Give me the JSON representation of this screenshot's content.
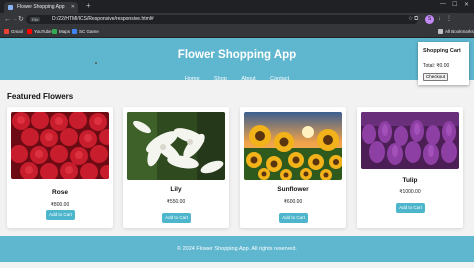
{
  "browser": {
    "tab_title": "Flower Shopping App",
    "url": "D:/22/HTMl/ICS/Responsive/responsive.html#",
    "file_chip": "File",
    "profile_letter": "S",
    "bookmarks": [
      {
        "label": "Gmail",
        "color": "#ea4335"
      },
      {
        "label": "YouTube",
        "color": "#ff0000"
      },
      {
        "label": "Maps",
        "color": "#34a853"
      },
      {
        "label": "SC Game",
        "color": "#4285f4"
      }
    ],
    "all_bookmarks": "All Bookmarks"
  },
  "header": {
    "title": "Flower Shopping App",
    "nav": [
      "Home",
      "Shop",
      "About",
      "Contact"
    ]
  },
  "cart": {
    "title": "Shopping Cart",
    "total": "Total: ₹0.00",
    "checkout": "Checkout"
  },
  "section": {
    "title": "Featured Flowers"
  },
  "products": [
    {
      "name": "Rose",
      "price": "₹800.00",
      "button": "Add to Cart",
      "image": "red-roses"
    },
    {
      "name": "Lily",
      "price": "₹550.00",
      "button": "Add to Cart",
      "image": "white-lilies"
    },
    {
      "name": "Sunflower",
      "price": "₹600.00",
      "button": "Add to Cart",
      "image": "sunflower-field"
    },
    {
      "name": "Tulip",
      "price": "₹1000.00",
      "button": "Add to Cart",
      "image": "purple-tulips"
    }
  ],
  "footer": {
    "text": "© 2024 Flower Shopping App. All rights reserved."
  },
  "colors": {
    "primary": "#5fb6cf",
    "button": "#4db5cc"
  }
}
